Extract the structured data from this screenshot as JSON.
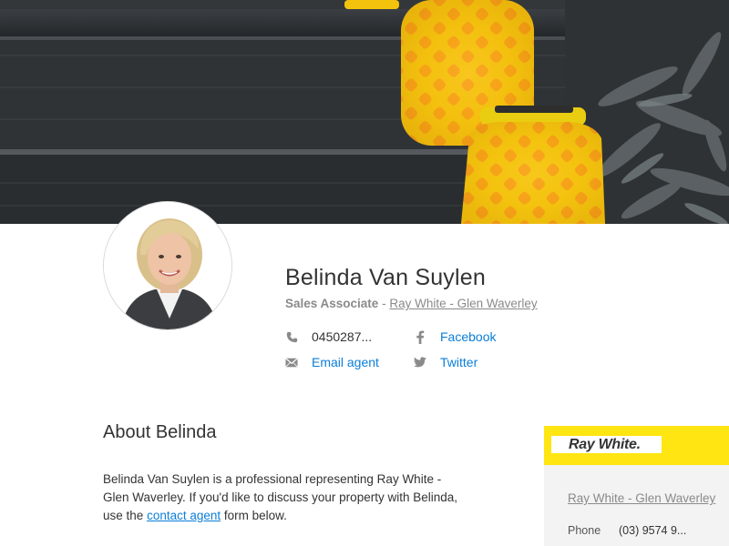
{
  "agent": {
    "name": "Belinda Van Suylen",
    "role": "Sales Associate",
    "separator": "-",
    "office_link": "Ray White - Glen Waverley"
  },
  "contacts": {
    "phone": "0450287...",
    "email": "Email agent",
    "facebook": "Facebook",
    "twitter": "Twitter"
  },
  "icons": {
    "phone": "phone-icon",
    "email": "envelope-icon",
    "facebook": "facebook-icon",
    "twitter": "twitter-icon"
  },
  "about": {
    "title": "About Belinda",
    "text_before": "Belinda Van Suylen is a professional representing Ray White - Glen Waverley. If you'd like to discuss your property with Belinda, use the",
    "link": "contact agent",
    "text_after": "form below."
  },
  "office": {
    "logo_text": "Ray White.",
    "name": "Ray White - Glen Waverley",
    "phone_label": "Phone",
    "phone_value": "(03) 9574 9..."
  },
  "colors": {
    "link_blue": "#0a7ed8",
    "brand_yellow": "#ffe512",
    "muted_grey": "#8a8a8a"
  }
}
